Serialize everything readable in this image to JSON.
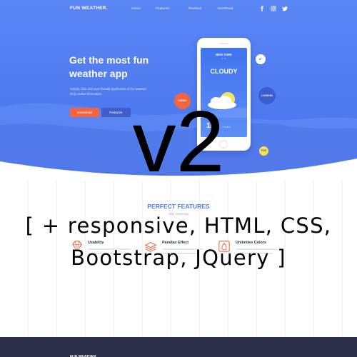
{
  "nav": {
    "brand": "FUN WEATHER.",
    "links": [
      "Home",
      "Features",
      "Reviews",
      "Download"
    ],
    "social_icons": [
      "facebook-icon",
      "instagram-icon",
      "twitter-icon"
    ]
  },
  "hero": {
    "title_line1": "Get the most fun",
    "title_line2": "weather app",
    "description": "Simple, nice and user-friendly application of the weather. Only useful information",
    "download_label": "Download",
    "features_label": "Features"
  },
  "phone": {
    "city": "NEW YORK",
    "sub": "9 ° 6",
    "condition": "CLOUDY",
    "temperature": "15",
    "wind": "☂ 5 KPH"
  },
  "bubbles": {
    "sunny": "SUNNY",
    "london": "LONDON",
    "yellow": "8°",
    "fog": "FOG"
  },
  "features": {
    "title": "PERFECT FEATURES",
    "subtitle": "Only necessary",
    "items": [
      {
        "name": "Usability",
        "icon": "diamond-icon"
      },
      {
        "name": "Parallax Effect",
        "icon": "layers-icon"
      },
      {
        "name": "Unlimites Colors",
        "icon": "drop-icon"
      }
    ]
  },
  "overlay": {
    "version": "v2",
    "stack_line1": "[ + responsive, HTML, CSS,",
    "stack_line2": "Bootstrap, JQuery ]"
  },
  "colors": {
    "hero_blue": "#5a86f5",
    "accent_orange": "#f4643f",
    "navy_button": "#3d5fc7",
    "footer": "#2b2f47",
    "feature_title": "#4f7cf2"
  }
}
